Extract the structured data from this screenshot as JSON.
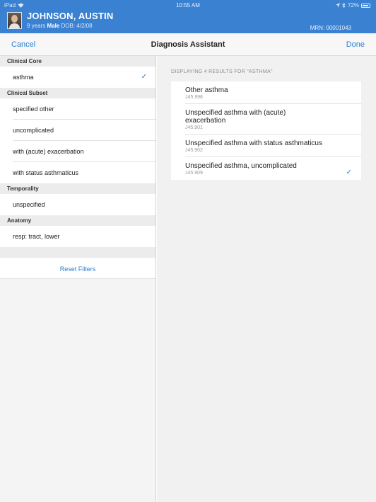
{
  "status_bar": {
    "device": "iPad",
    "time": "10:55 AM",
    "battery": "72%"
  },
  "patient": {
    "name": "JOHNSON, AUSTIN",
    "age": "9 years",
    "sex": "Male",
    "dob": "DOB: 4/2/08",
    "mrn": "MRN: 00001043"
  },
  "nav": {
    "cancel": "Cancel",
    "title": "Diagnosis Assistant",
    "done": "Done"
  },
  "filters": {
    "clinical_core": {
      "header": "Clinical Core",
      "item": "asthma"
    },
    "clinical_subset": {
      "header": "Clinical Subset",
      "items": [
        "specified other",
        "uncomplicated",
        "with (acute) exacerbation",
        "with status asthmaticus"
      ]
    },
    "temporality": {
      "header": "Temporality",
      "item": "unspecified"
    },
    "anatomy": {
      "header": "Anatomy",
      "item": "resp: tract, lower"
    },
    "reset_label": "Reset Filters"
  },
  "results": {
    "header": "DISPLAYING 4 RESULTS FOR \"ASTHMA\"",
    "items": [
      {
        "title": "Other asthma",
        "code": "J45.998"
      },
      {
        "title": "Unspecified asthma with (acute) exacerbation",
        "code": "J45.901"
      },
      {
        "title": "Unspecified asthma with status asthmaticus",
        "code": "J45.902"
      },
      {
        "title": "Unspecified asthma, uncomplicated",
        "code": "J45.909"
      }
    ]
  },
  "colors": {
    "accent": "#2a7fd4",
    "header_blue": "#3a82d1"
  }
}
